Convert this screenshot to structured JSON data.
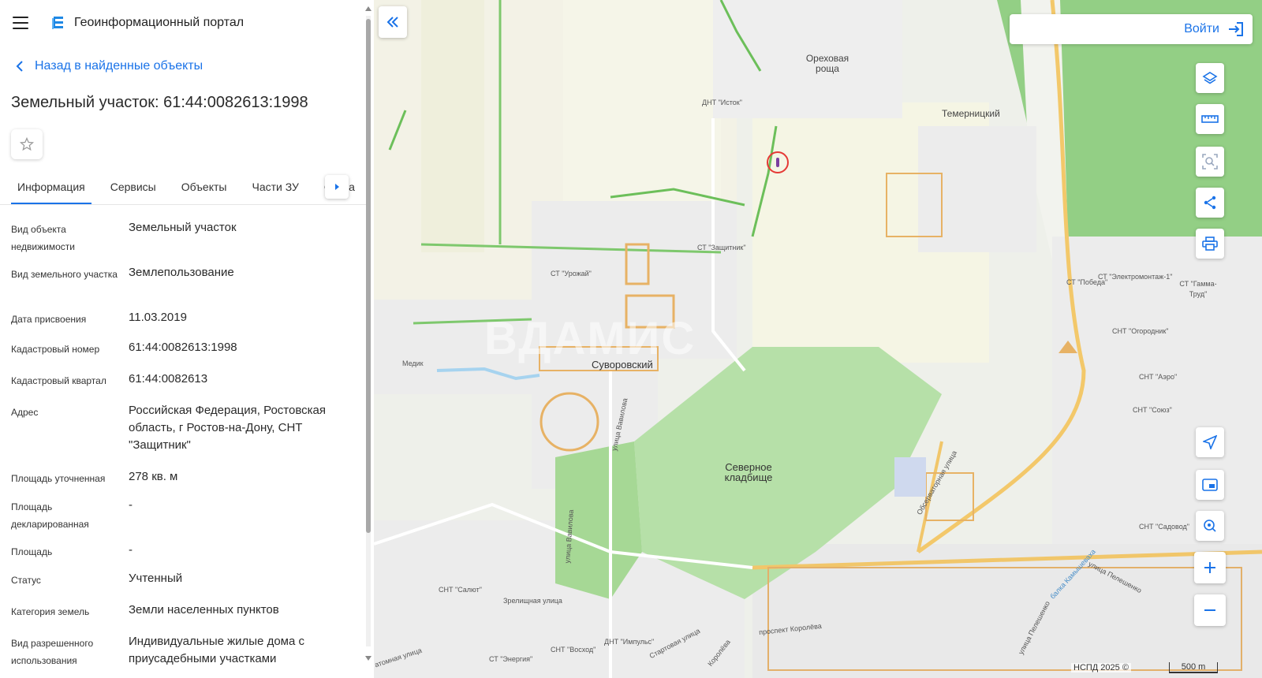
{
  "app": {
    "title": "Геоинформационный портал"
  },
  "nav": {
    "back_label": "Назад в найденные объекты"
  },
  "object": {
    "title": "Земельный участок: 61:44:0082613:1998"
  },
  "tabs": [
    {
      "label": "Информация",
      "active": true
    },
    {
      "label": "Сервисы"
    },
    {
      "label": "Объекты"
    },
    {
      "label": "Части ЗУ"
    },
    {
      "label": "Соста"
    }
  ],
  "info": [
    {
      "key": "Вид объекта недвижимости",
      "value": "Земельный участок"
    },
    {
      "key": "Вид земельного участка",
      "value": "Землепользование"
    },
    {
      "key": "Дата присвоения",
      "value": "11.03.2019"
    },
    {
      "key": "Кадастровый номер",
      "value": "61:44:0082613:1998"
    },
    {
      "key": "Кадастровый квартал",
      "value": "61:44:0082613"
    },
    {
      "key": "Адрес",
      "value": "Российская Федерация, Ростовская область, г Ростов-на-Дону, СНТ \"Защитник\""
    },
    {
      "key": "Площадь уточненная",
      "value": "278 кв. м"
    },
    {
      "key": "Площадь декларированная",
      "value": "-"
    },
    {
      "key": "Площадь",
      "value": "-"
    },
    {
      "key": "Статус",
      "value": "Учтенный"
    },
    {
      "key": "Категория земель",
      "value": "Земли населенных пунктов"
    },
    {
      "key": "Вид разрешенного использования",
      "value": "Индивидуальные жилые дома с приусадебными участками"
    }
  ],
  "map": {
    "login_label": "Войти",
    "attribution": "НСПД 2025 ©",
    "scale": "500 m",
    "watermark": "ВДАМИС",
    "labels": {
      "orekhovaya": "Ореховая роща",
      "temernitsky": "Темерницкий",
      "dnt_istok": "ДНТ \"Исток\"",
      "st_zashchitnik": "СТ \"Защитник\"",
      "st_urozhai": "СТ \"Урожай\"",
      "suvorovsky": "Суворовский",
      "medik": "Медик",
      "vavilova": "улица Вавилова",
      "vavilova2": "улица Вавилова",
      "severnoe": "Северное кладбище",
      "observatornaya": "Обсерваторная улица",
      "zrelishchnaya": "Зрелищная улица",
      "snt_salyut": "СНТ \"Салют\"",
      "st_energiya": "СТ \"Энергия\"",
      "snt_voskhod": "СНТ \"Восход\"",
      "dnt_impuls": "ДНТ \"Импульс\"",
      "startovaya": "Стартовая улица",
      "koroleva_prospekt": "проспект Королёва",
      "koroleva": "Королёва",
      "pelevhenko": "улица Пелешенко",
      "pelevhenko2": "улица Пелешенко",
      "kamyshevakha": "балка Камышеваха",
      "st_pobeda": "СТ \"Победа\"",
      "st_ektsemontazh": "СТ \"Электромонтаж-1\"",
      "st_gamma": "СТ \"Гамма-Труд\"",
      "snt_ogorodnik": "СНТ \"Огородник\"",
      "snt_aero": "СНТ \"Аэро\"",
      "snt_soyuz": "СНТ \"Союз\"",
      "snt_sadovod": "СНТ \"Садовод\"",
      "atomnaya": "атомная улица"
    }
  }
}
